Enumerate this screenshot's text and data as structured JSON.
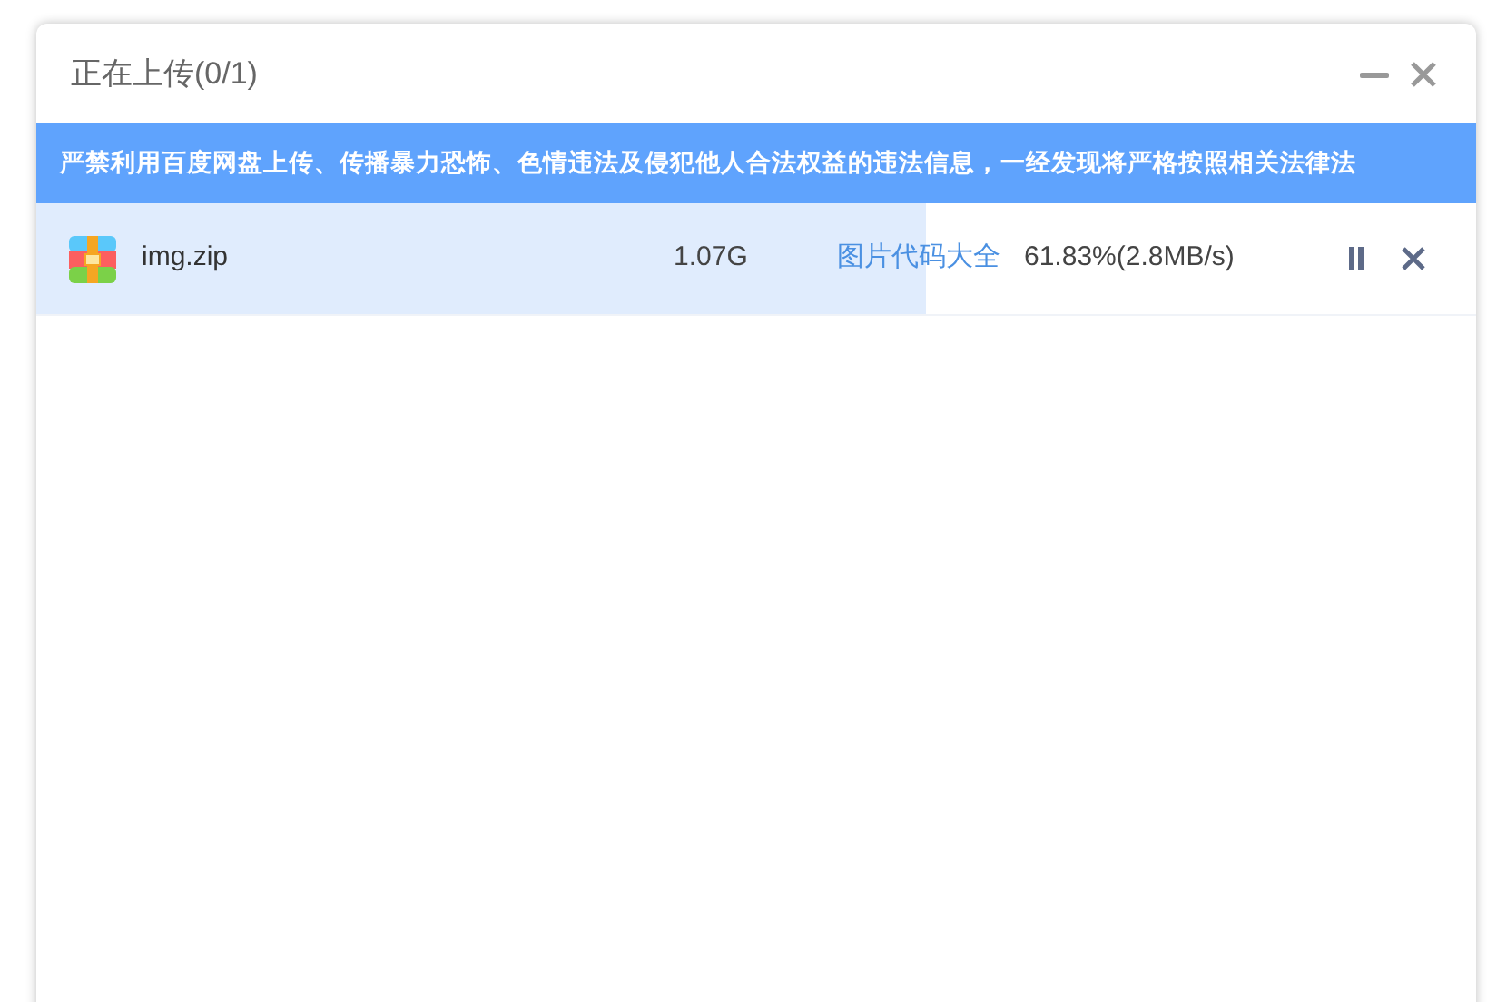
{
  "window": {
    "title": "正在上传(0/1)"
  },
  "notice": "严禁利用百度网盘上传、传播暴力恐怖、色情违法及侵犯他人合法权益的违法信息，一经发现将严格按照相关法律法",
  "uploads": [
    {
      "name": "img.zip",
      "size": "1.07G",
      "destination": "图片代码大全",
      "progress": "61.83%(2.8MB/s)",
      "level": 0.6183,
      "paused": false
    }
  ]
}
